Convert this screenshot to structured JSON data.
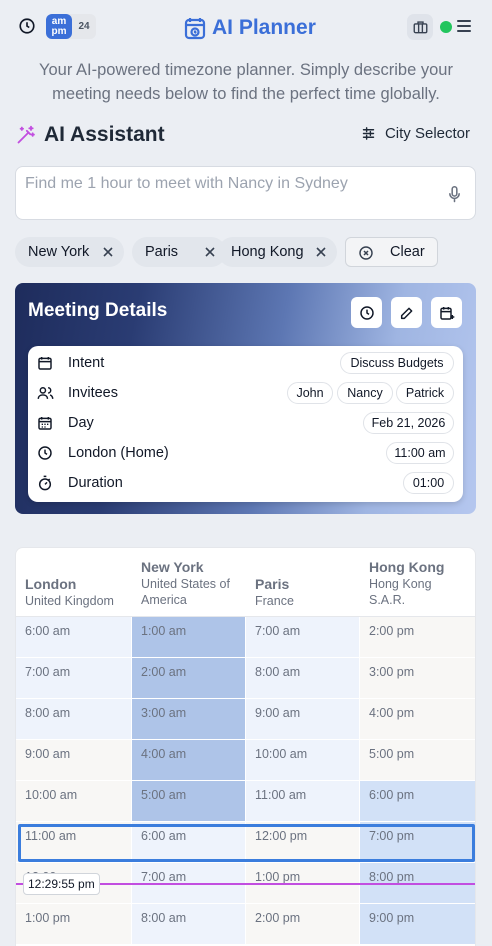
{
  "header": {
    "ampm_top": "am",
    "ampm_bottom": "pm",
    "ampm_24": "24",
    "title": "AI Planner",
    "status_color": "#22c55e"
  },
  "tagline": "Your AI-powered timezone planner. Simply describe your meeting needs below to find the perfect time globally.",
  "assistant": {
    "title": "AI Assistant",
    "city_selector_label": "City Selector",
    "search_placeholder": "Find me 1 hour to meet with Nancy in Sydney"
  },
  "chips": [
    "New York",
    "Paris",
    "Hong Kong"
  ],
  "clear_label": "Clear",
  "meeting": {
    "title": "Meeting Details",
    "intent_label": "Intent",
    "intent_value": "Discuss Budgets",
    "invitees_label": "Invitees",
    "invitees": [
      "John",
      "Nancy",
      "Patrick"
    ],
    "day_label": "Day",
    "day_value": "Feb 21, 2026",
    "location_label": "London (Home)",
    "location_value": "11:00 am",
    "duration_label": "Duration",
    "duration_value": "01:00"
  },
  "grid": {
    "columns": [
      {
        "name": "London",
        "sub": "United Kingdom"
      },
      {
        "name": "New York",
        "sub": "United States of America"
      },
      {
        "name": "Paris",
        "sub": "France"
      },
      {
        "name": "Hong Kong",
        "sub": "Hong Kong S.A.R."
      }
    ],
    "rows": [
      [
        "6:00 am",
        "1:00 am",
        "7:00 am",
        "2:00 pm"
      ],
      [
        "7:00 am",
        "2:00 am",
        "8:00 am",
        "3:00 pm"
      ],
      [
        "8:00 am",
        "3:00 am",
        "9:00 am",
        "4:00 pm"
      ],
      [
        "9:00 am",
        "4:00 am",
        "10:00 am",
        "5:00 pm"
      ],
      [
        "10:00 am",
        "5:00 am",
        "11:00 am",
        "6:00 pm"
      ],
      [
        "11:00 am",
        "6:00 am",
        "12:00 pm",
        "7:00 pm"
      ],
      [
        "12:00 pm",
        "7:00 am",
        "1:00 pm",
        "8:00 pm"
      ],
      [
        "1:00 pm",
        "8:00 am",
        "2:00 pm",
        "9:00 pm"
      ]
    ],
    "selected_row": 5,
    "current_time": "12:29:55 pm",
    "colors": {
      "working": "#eef3fc",
      "night": "#aec4e8",
      "evening": "#d2e1f7",
      "neutral": "#f8f7f5",
      "now_line": "#c24ee0",
      "selection": "#3b7ddd"
    }
  }
}
